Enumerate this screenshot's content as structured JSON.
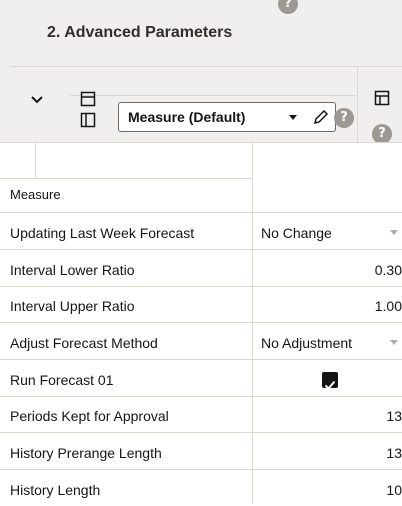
{
  "panel": {
    "title": "2. Advanced Parameters"
  },
  "toolbar": {
    "help_glyph": "?",
    "measure_select": {
      "selected": "Measure (Default)"
    }
  },
  "grid": {
    "header": {
      "label": "Measure"
    },
    "rows": [
      {
        "label": "Updating Last Week Forecast",
        "value": "No Change",
        "kind": "dropdown"
      },
      {
        "label": "Interval Lower Ratio",
        "value": "0.30",
        "kind": "number"
      },
      {
        "label": "Interval Upper Ratio",
        "value": "1.00",
        "kind": "number"
      },
      {
        "label": "Adjust Forecast Method",
        "value": "No Adjustment",
        "kind": "dropdown"
      },
      {
        "label": "Run Forecast 01",
        "value": "checked",
        "kind": "checkbox"
      },
      {
        "label": "Periods Kept for Approval",
        "value": "13",
        "kind": "number"
      },
      {
        "label": "History Prerange Length",
        "value": "13",
        "kind": "number"
      },
      {
        "label": "History Length",
        "value": "10",
        "kind": "number"
      }
    ]
  },
  "colors": {
    "header_bg": "#f1efed",
    "grid_line": "#dcd8d4",
    "help_bg": "#9e9892"
  }
}
